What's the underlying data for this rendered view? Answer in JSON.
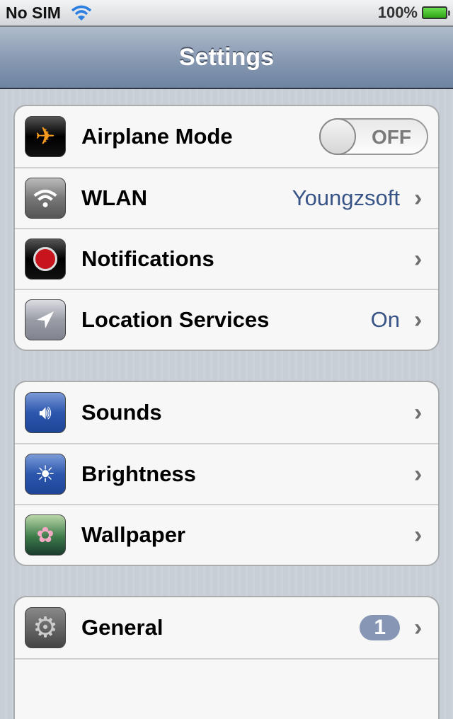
{
  "status_bar": {
    "carrier": "No SIM",
    "battery": "100%"
  },
  "nav": {
    "title": "Settings"
  },
  "groups": [
    {
      "items": [
        {
          "label": "Airplane Mode",
          "toggle": "OFF"
        },
        {
          "label": "WLAN",
          "value": "Youngzsoft"
        },
        {
          "label": "Notifications"
        },
        {
          "label": "Location Services",
          "value": "On"
        }
      ]
    },
    {
      "items": [
        {
          "label": "Sounds"
        },
        {
          "label": "Brightness"
        },
        {
          "label": "Wallpaper"
        }
      ]
    },
    {
      "items": [
        {
          "label": "General",
          "badge": "1"
        }
      ]
    }
  ],
  "chevron": "›"
}
